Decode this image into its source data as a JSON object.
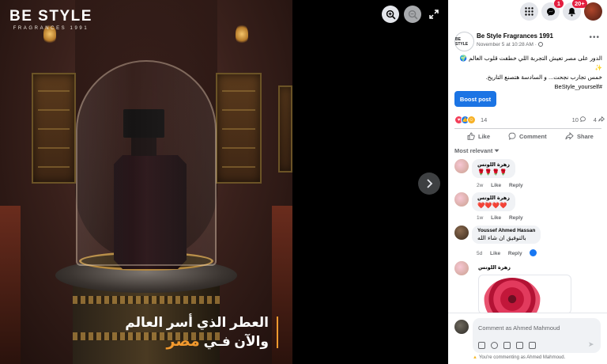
{
  "photo": {
    "brand_name": "BE STYLE",
    "brand_sub": "FRAGRANCES 1991",
    "tagline_line1": "العطر الذي أسر العالم",
    "tagline_line2_start": "والآن فـي",
    "tagline_line2_accent": "مصر"
  },
  "topbar": {
    "messenger_badge": "1",
    "notifications_badge": "20+"
  },
  "post": {
    "page_avatar_text": "BE STYLE",
    "page_name": "Be Style Fragrances 1991",
    "timestamp": "November 5 at 10:28 AM ·",
    "text_line1": "الدور على مصر تعيش التجربة اللي خطفت قلوب العالم 🌍✨",
    "text_line2": "خمس تجارب نجحت... و السادسة هتصنع التاريخ.",
    "hashtag": "#BeStyle_yourself",
    "boost_label": "Boost post",
    "reaction_count": "14",
    "comment_count": "10",
    "share_count": "4",
    "like_label": "Like",
    "comment_label": "Comment",
    "share_label": "Share",
    "sort_label": "Most relevant"
  },
  "comments": [
    {
      "author": "زهرة اللوتس",
      "text": "🌹🌹🌹🌹",
      "age": "2w",
      "like": "Like",
      "reply": "Reply"
    },
    {
      "author": "زهرة اللوتس",
      "text": "❤️❤️❤️❤️",
      "age": "1w",
      "like": "Like",
      "reply": "Reply"
    },
    {
      "author": "Youssef Ahmed Hassan",
      "text": "بالتوفيق ان شاء الله",
      "age": "5d",
      "like": "Like",
      "reply": "Reply"
    },
    {
      "author": "زهرة اللوتس"
    }
  ],
  "composer": {
    "placeholder": "Comment as Ahmed Mahmoud",
    "notice": "You're commenting as Ahmed Mahmoud."
  },
  "colors": {
    "accent_blue": "#1b74e4",
    "tagline_accent": "#f39a2e",
    "badge_red": "#e41e3f"
  }
}
